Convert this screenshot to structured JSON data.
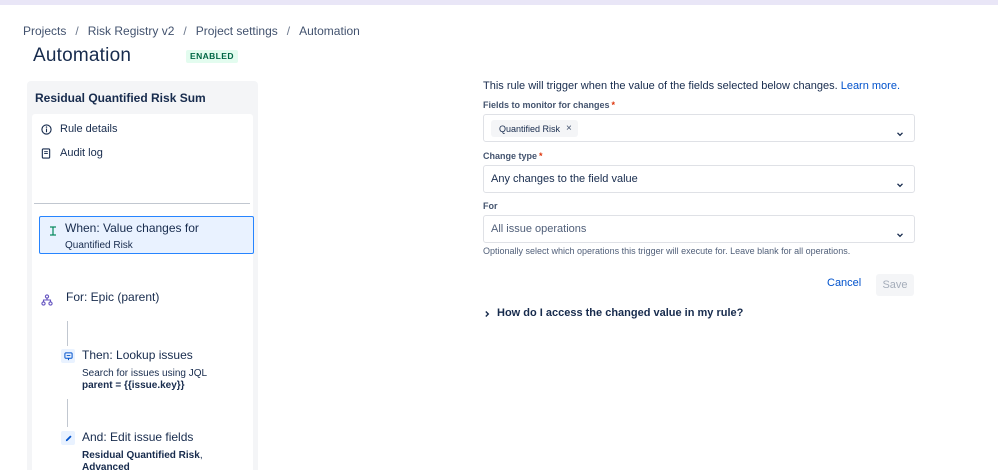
{
  "breadcrumb": [
    "Projects",
    "Risk Registry v2",
    "Project settings",
    "Automation"
  ],
  "breadcrumb_separator": "/",
  "page": {
    "title": "Automation",
    "status": "ENABLED"
  },
  "rule": {
    "name": "Residual Quantified Risk Sum",
    "menu": [
      {
        "label": "Rule details",
        "icon": "info-icon"
      },
      {
        "label": "Audit log",
        "icon": "audit-log-icon"
      }
    ],
    "trigger": {
      "title": "When: Value changes for",
      "subtitle": "Quantified Risk",
      "icon": "trigger-icon"
    },
    "branch": {
      "title": "For: Epic (parent)",
      "icon": "branch-icon"
    },
    "actions": [
      {
        "title": "Then: Lookup issues",
        "desc": "Search for issues using JQL",
        "desc_bold": "parent = {{issue.key}}",
        "icon": "lookup-icon"
      },
      {
        "title": "And: Edit issue fields",
        "desc_bold": "Residual Quantified Risk",
        "desc_suffix": ",",
        "desc_bold2": "Advanced",
        "icon": "pencil-icon"
      }
    ]
  },
  "form": {
    "intro": "This rule will trigger when the value of the fields selected below changes.",
    "learn_more": "Learn more.",
    "fields_label": "Fields to monitor for changes",
    "fields_tags": [
      "Quantified Risk"
    ],
    "change_type_label": "Change type",
    "change_type_value": "Any changes to the field value",
    "for_label": "For",
    "for_placeholder": "All issue operations",
    "for_helper": "Optionally select which operations this trigger will execute for. Leave blank for all operations.",
    "required_marker": "*",
    "cancel_label": "Cancel",
    "save_label": "Save",
    "faq": "How do I access the changed value in my rule?"
  },
  "colors": {
    "accent": "#0052cc",
    "selected_bg": "#e9f2ff",
    "selected_border": "#2684ff",
    "enabled_bg": "#e3fcef",
    "enabled_text": "#006644"
  }
}
